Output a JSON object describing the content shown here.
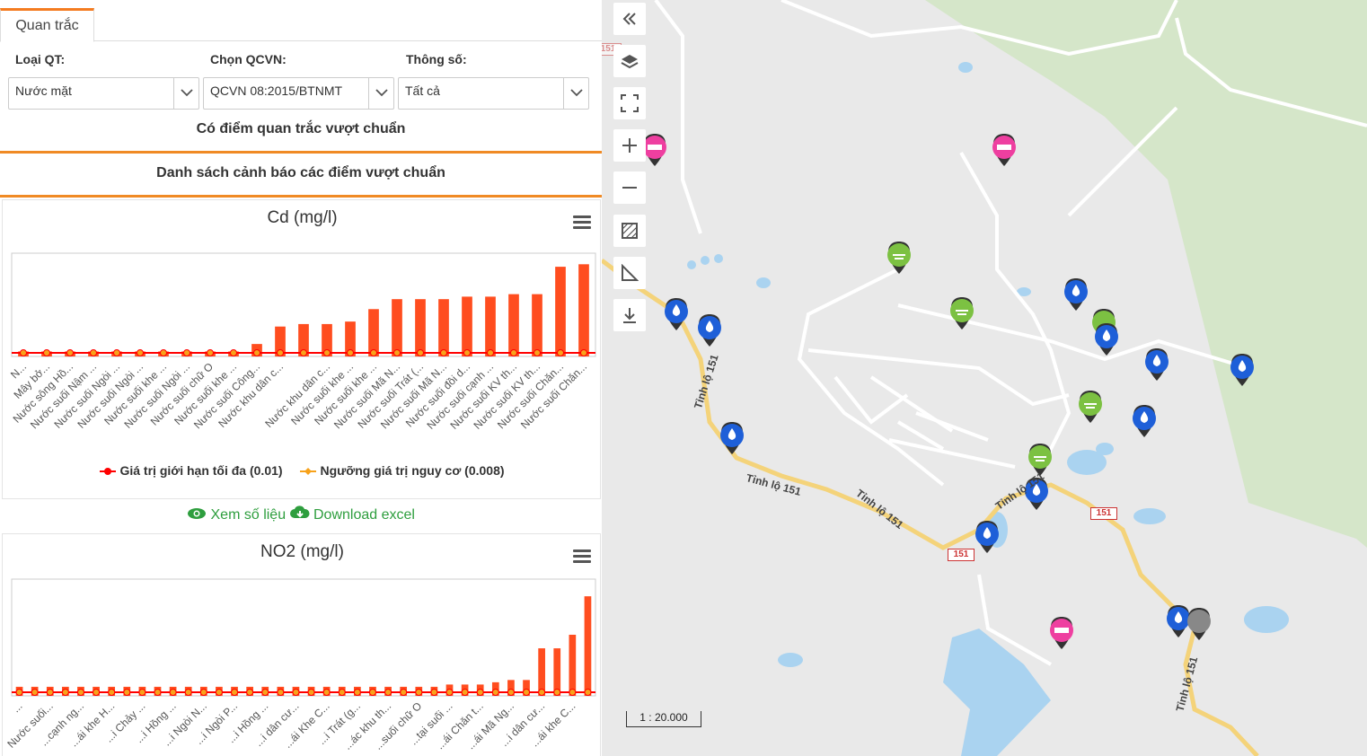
{
  "tabs": [
    {
      "label": "Quan trắc"
    }
  ],
  "filters": {
    "loai_qt": {
      "label": "Loại QT:",
      "value": "Nước mặt"
    },
    "qcvn": {
      "label": "Chọn QCVN:",
      "value": "QCVN 08:2015/BTNMT"
    },
    "thong_so": {
      "label": "Thông số:",
      "value": "Tất cả"
    }
  },
  "notice": "Có điểm quan trắc vượt chuẩn",
  "list_title": "Danh sách cảnh báo các điểm vượt chuẩn",
  "links": {
    "view": "Xem số liệu",
    "download": "Download excel"
  },
  "colors": {
    "bar": "#ff4d1f",
    "limit": "#ff0000",
    "risk": "#f7a21b",
    "accent": "#f08a24",
    "link": "#2e9e3e"
  },
  "chart_data": [
    {
      "type": "bar",
      "title": "Cd (mg/l)",
      "categories": [
        "N...",
        "Mây bở...",
        "Nước sông Hồ...",
        "Nước suối Nậm ...",
        "Nước suối Ngòi ...",
        "Nước suối Ngòi ...",
        "Nước suối khe ...",
        "Nước suối Ngòi ...",
        "Nước suối chữ O",
        "Nước suối khe ...",
        "Nước suối Công...",
        "Nước khu dân c...",
        "Nước khu dân c...",
        "Nước suối khe ...",
        "Nước suối khe ...",
        "Nước suối Mã N...",
        "Nước suối Trát (...",
        "Nước suối Mã N...",
        "Nước suối đồi d...",
        "Nước suối cạnh ...",
        "Nước suối KV th...",
        "Nước suối KV th...",
        "Nước suối Chăn...",
        "Nước suối Chăn..."
      ],
      "values": [
        0.002,
        0.002,
        0.002,
        0.002,
        0.002,
        0.002,
        0.002,
        0.002,
        0.002,
        0.002,
        0.005,
        0.012,
        0.013,
        0.013,
        0.014,
        0.019,
        0.023,
        0.023,
        0.023,
        0.024,
        0.024,
        0.025,
        0.025,
        0.036,
        0.037
      ],
      "ylim": [
        0,
        0.04
      ],
      "series": [
        {
          "name": "Giá trị giới hạn tối đa (0.01)",
          "type": "line",
          "value": 0.01,
          "color": "#ff0000"
        },
        {
          "name": "Ngưỡng giá trị nguy cơ (0.008)",
          "type": "line",
          "value": 0.008,
          "color": "#f7a21b"
        }
      ],
      "legend": "bottom"
    },
    {
      "type": "bar",
      "title": "NO2 (mg/l)",
      "categories": [
        "...",
        "Nước suối...",
        "...cạnh ng...",
        "...ái khe H...",
        "...i Chảy ...",
        "...i Hồng ...",
        "...i Ngòi N...",
        "...i Ngòi P...",
        "...i Hồng ...",
        "...i dân cư...",
        "...ái Khe C...",
        "...i Trát (g...",
        "...ác khu th...",
        "...suối chữ O",
        "...tại suối ...",
        "...ái Chăn t...",
        "...ái Mã Ng...",
        "...i dân cư...",
        "...ái khe C..."
      ],
      "values": [
        0.004,
        0.004,
        0.004,
        0.004,
        0.004,
        0.004,
        0.004,
        0.004,
        0.004,
        0.004,
        0.004,
        0.004,
        0.004,
        0.004,
        0.004,
        0.004,
        0.004,
        0.004,
        0.004,
        0.004,
        0.004,
        0.004,
        0.004,
        0.004,
        0.004,
        0.004,
        0.004,
        0.004,
        0.005,
        0.005,
        0.005,
        0.006,
        0.007,
        0.007,
        0.021,
        0.021,
        0.027,
        0.044
      ],
      "ylim": [
        0,
        0.05
      ],
      "legend": "none"
    }
  ],
  "map": {
    "scale": "1 : 20.000",
    "road_labels": [
      "Tỉnh lộ 151",
      "Tỉnh lộ 151",
      "Tỉnh lộ 151",
      "Tỉnh lộ 151",
      "Tỉnh lộ 151"
    ],
    "shields": [
      "151",
      "151",
      "151"
    ],
    "controls": [
      "collapse-icon",
      "layers-icon",
      "fullscreen-icon",
      "zoom-in-icon",
      "zoom-out-icon",
      "select-area-icon",
      "measure-icon",
      "download-icon"
    ]
  }
}
